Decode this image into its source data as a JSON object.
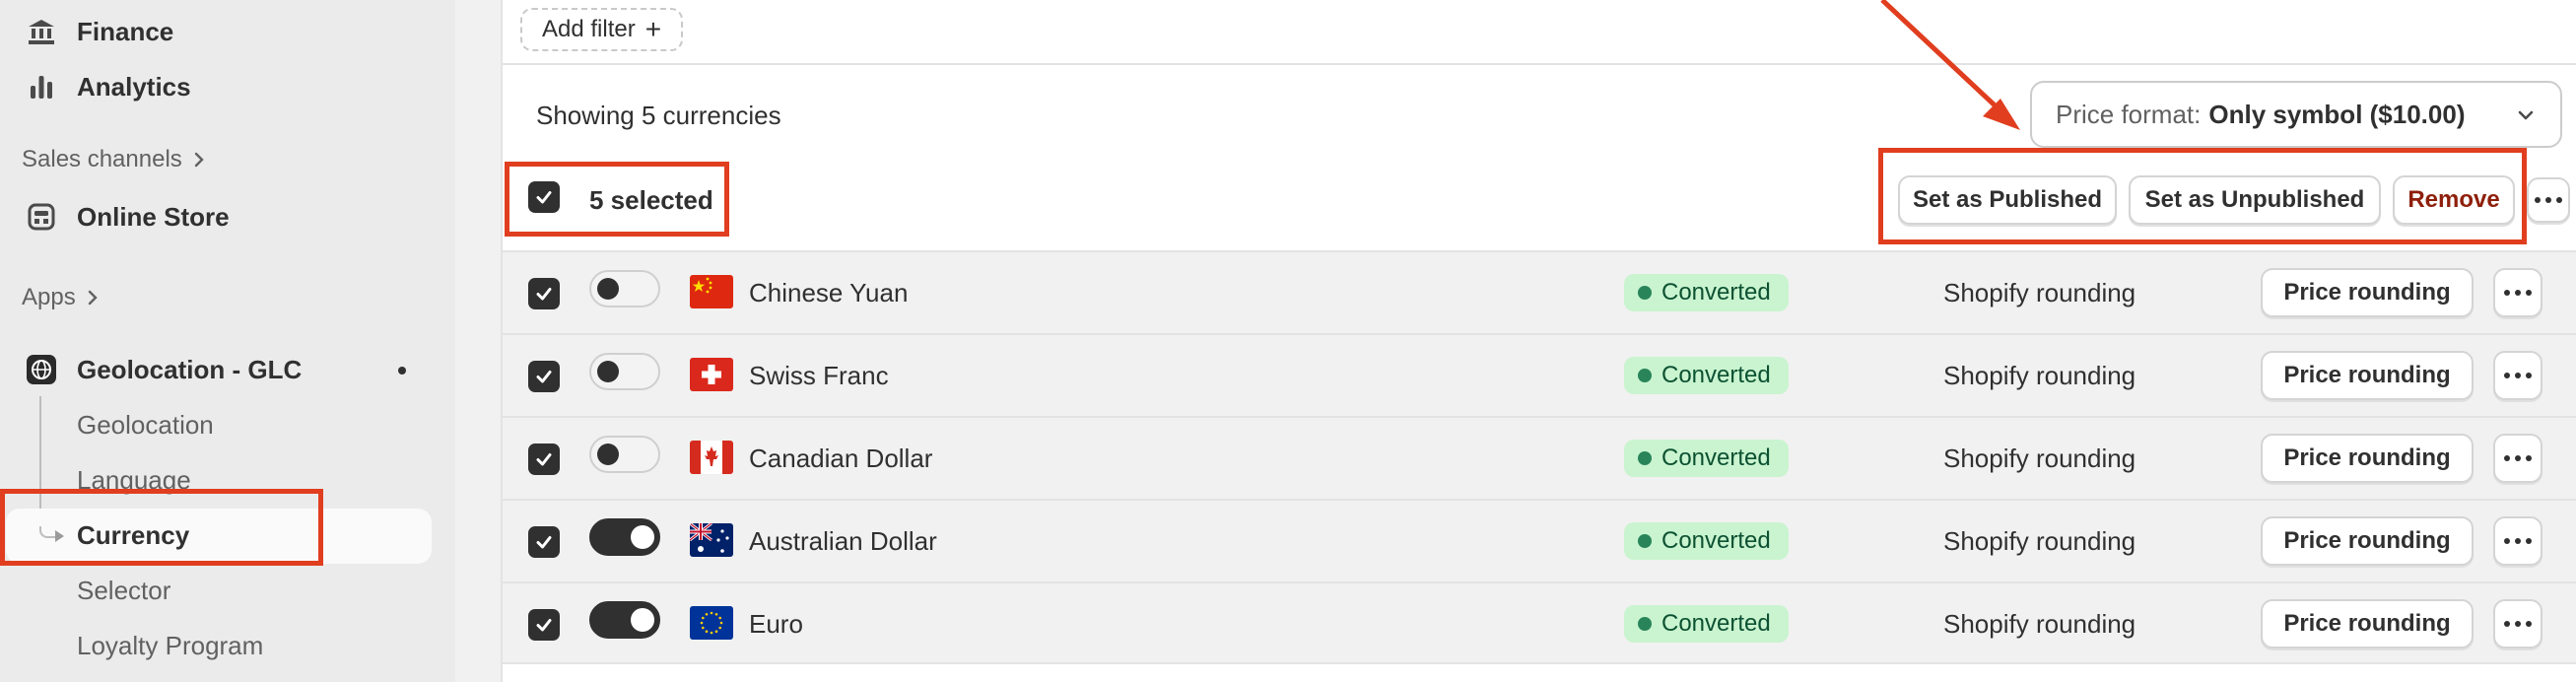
{
  "sidebar": {
    "finance": "Finance",
    "analytics": "Analytics",
    "sales_channels": "Sales channels",
    "online_store": "Online Store",
    "apps": "Apps",
    "app_name": "Geolocation - GLC",
    "sub_items": [
      "Geolocation",
      "Language",
      "Currency",
      "Selector",
      "Loyalty Program"
    ],
    "active_sub_item": "Currency"
  },
  "toolbar": {
    "add_filter": "Add filter",
    "showing": "Showing 5 currencies",
    "price_format_label": "Price format:",
    "price_format_value": "Only symbol ($10.00)"
  },
  "bulk": {
    "selected": "5 selected",
    "publish": "Set as Published",
    "unpublish": "Set as Unpublished",
    "remove": "Remove"
  },
  "currencies": [
    {
      "name": "Chinese Yuan",
      "status": "Converted",
      "rounding": "Shopify rounding",
      "action": "Price rounding",
      "published": false,
      "checked": true,
      "flag": "china-flag-icon"
    },
    {
      "name": "Swiss Franc",
      "status": "Converted",
      "rounding": "Shopify rounding",
      "action": "Price rounding",
      "published": false,
      "checked": true,
      "flag": "switzerland-flag-icon"
    },
    {
      "name": "Canadian Dollar",
      "status": "Converted",
      "rounding": "Shopify rounding",
      "action": "Price rounding",
      "published": false,
      "checked": true,
      "flag": "canada-flag-icon"
    },
    {
      "name": "Australian Dollar",
      "status": "Converted",
      "rounding": "Shopify rounding",
      "action": "Price rounding",
      "published": true,
      "checked": true,
      "flag": "australia-flag-icon"
    },
    {
      "name": "Euro",
      "status": "Converted",
      "rounding": "Shopify rounding",
      "action": "Price rounding",
      "published": true,
      "checked": true,
      "flag": "eu-flag-icon"
    }
  ],
  "colors": {
    "annotation": "#e03e1f",
    "badge_bg": "#c9f4cf",
    "badge_dot": "#29845a",
    "danger": "#8e1f0b"
  }
}
